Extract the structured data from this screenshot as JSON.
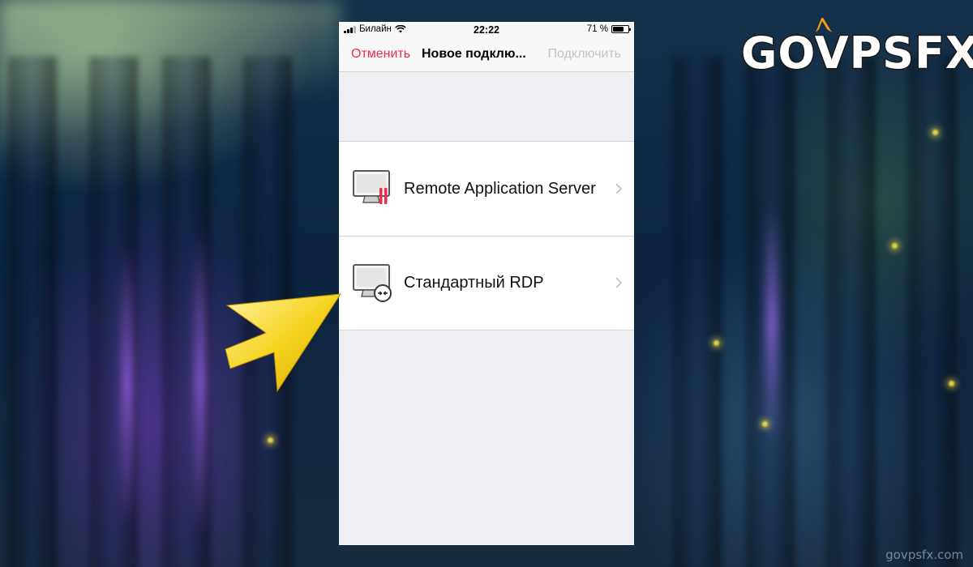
{
  "status_bar": {
    "carrier": "Билайн",
    "time": "22:22",
    "battery_text": "71 %",
    "battery_level": 0.71,
    "wifi_icon": "wifi-icon"
  },
  "nav": {
    "cancel_label": "Отменить",
    "title": "Новое подклю...",
    "connect_label": "Подключить"
  },
  "connection_types": [
    {
      "label": "Remote Application Server",
      "icon": "remote-app-server-icon"
    },
    {
      "label": "Стандартный RDP",
      "icon": "rdp-monitor-icon"
    }
  ],
  "branding": {
    "logo_text": "GOVPSFX",
    "watermark": "govpsfx.com"
  },
  "colors": {
    "accent": "#e8304d",
    "disabled": "#c4c4c8",
    "pointer_arrow": "#f6d320"
  }
}
